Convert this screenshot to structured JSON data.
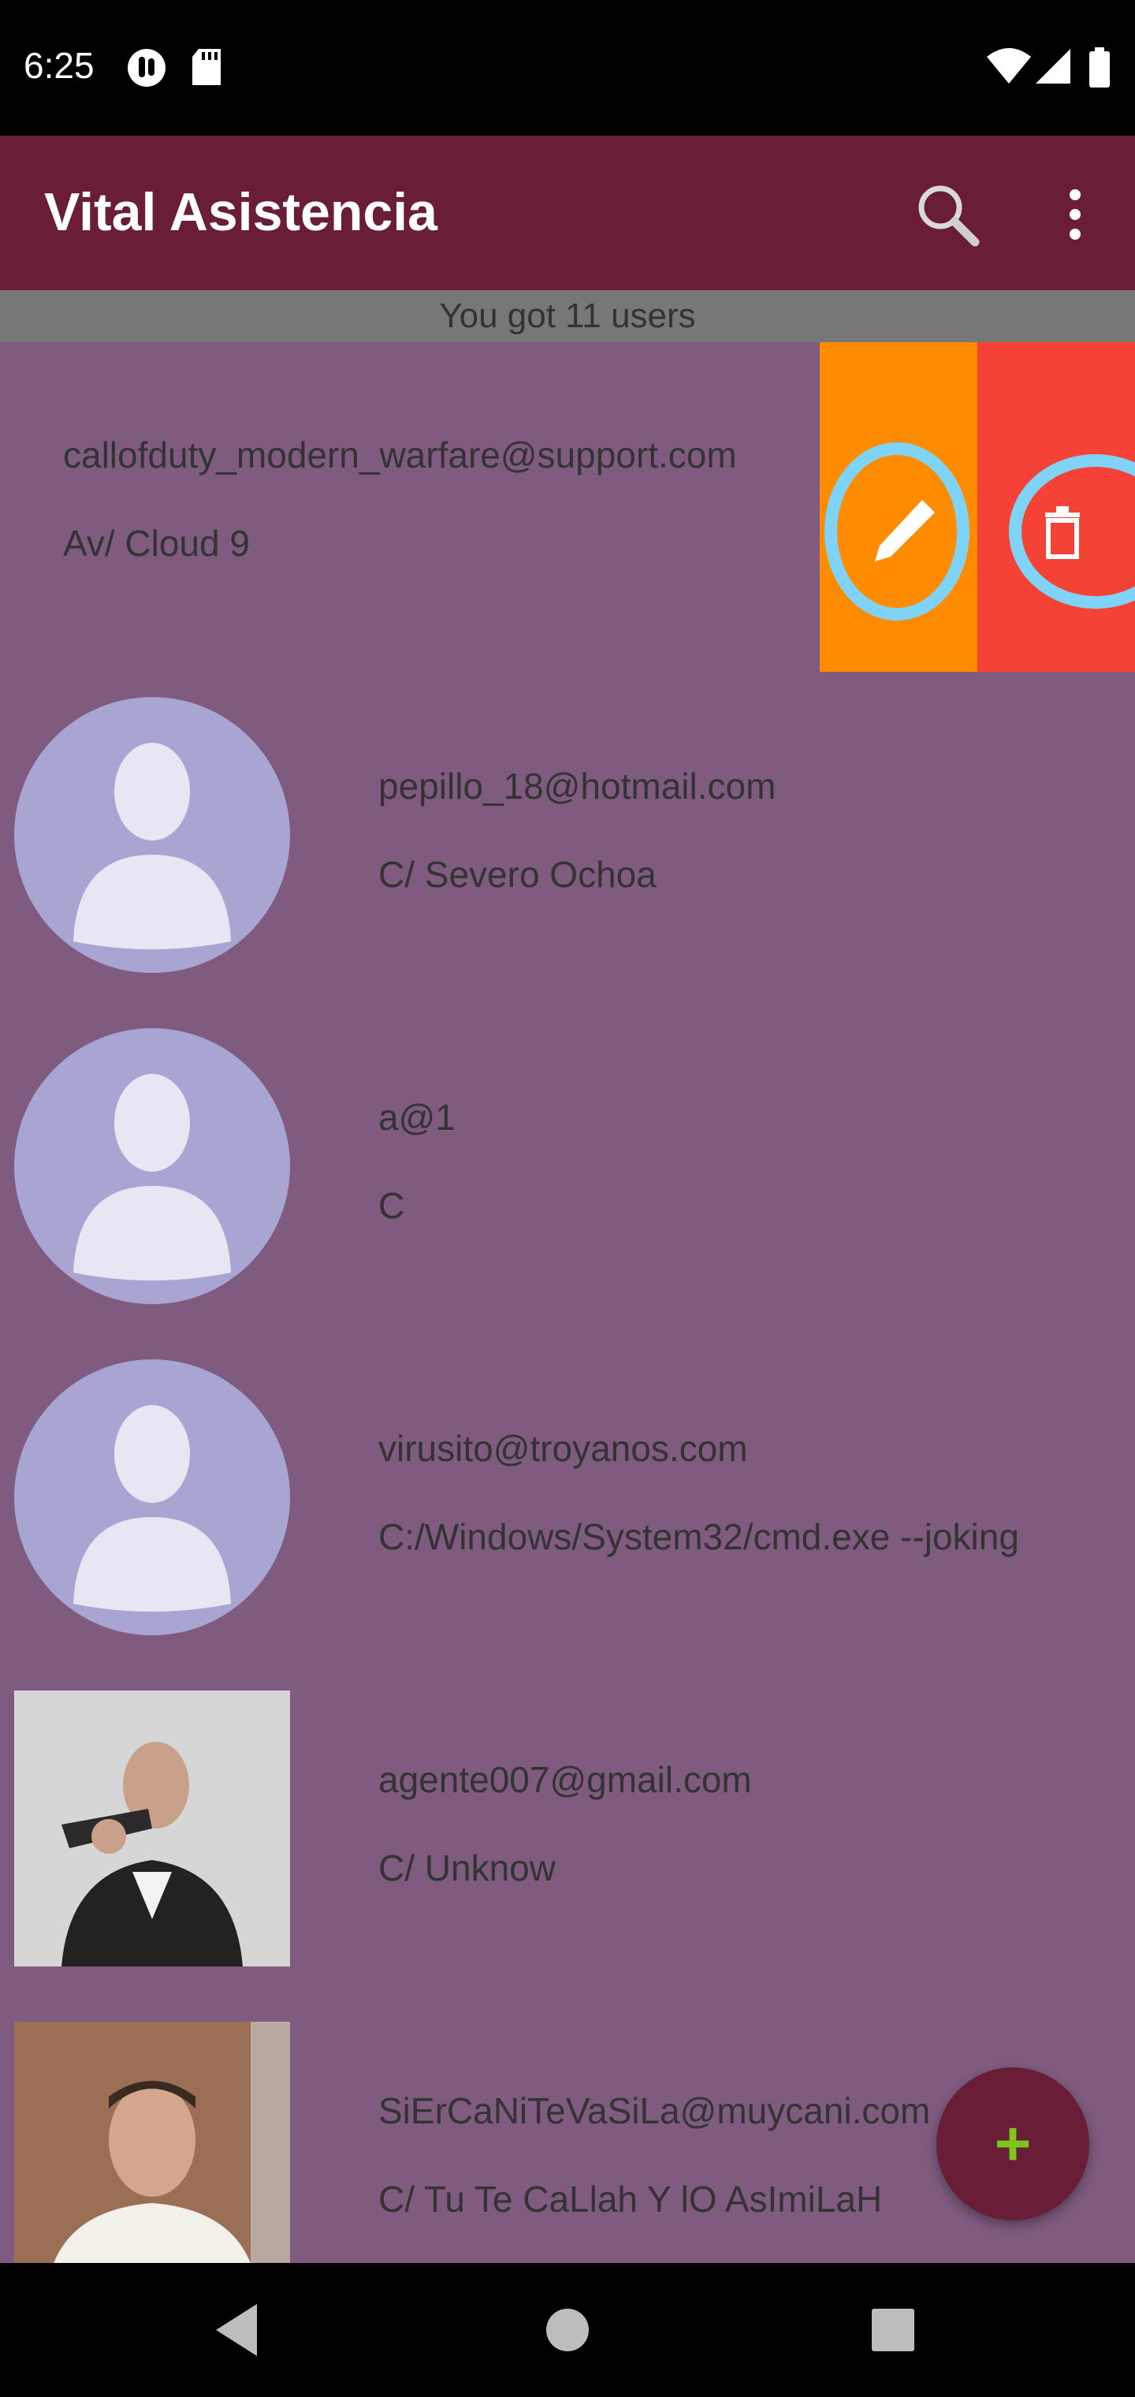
{
  "status_bar": {
    "time": "6:25",
    "icons": [
      "notification-app-icon",
      "sd-card-icon",
      "wifi-icon",
      "signal-icon",
      "battery-icon"
    ]
  },
  "app_bar": {
    "title": "Vital Asistencia",
    "actions": [
      "search-icon",
      "more-options-icon"
    ]
  },
  "user_count": "You got 11 users",
  "users": [
    {
      "email": "callofduty_modern_warfare@support.com",
      "address": "Av/ Cloud 9",
      "avatar": "none",
      "swiped": true
    },
    {
      "email": "pepillo_18@hotmail.com",
      "address": "C/ Severo Ochoa",
      "avatar": "default-avatar"
    },
    {
      "email": "a@1",
      "address": "C",
      "avatar": "default-avatar"
    },
    {
      "email": "virusito@troyanos.com",
      "address": "C:/Windows/System32/cmd.exe --joking",
      "avatar": "default-avatar"
    },
    {
      "email": "agente007@gmail.com",
      "address": "C/ Unknow",
      "avatar": "photo-man-with-gun"
    },
    {
      "email": "SiErCaNiTeVaSiLa@muycani.com",
      "address": "C/ Tu Te CaLlah Y lO AsImiLaH",
      "avatar": "photo-man-white-sweater"
    }
  ],
  "swipe_actions": {
    "edit": "pencil-icon",
    "delete": "trash-icon"
  },
  "fab": {
    "label": "+"
  },
  "nav_bar": [
    "back-icon",
    "home-icon",
    "recents-icon"
  ],
  "colors": {
    "app_bar": "#6a1d36",
    "list_bg": "#7e5b7f",
    "count_bar": "#777777",
    "edit_action": "#ff8c00",
    "delete_action": "#f44336",
    "fab_plus": "#7cc51f",
    "avatar_circle": "#a8a5d3",
    "highlight_circle": "#7fd3f7"
  }
}
